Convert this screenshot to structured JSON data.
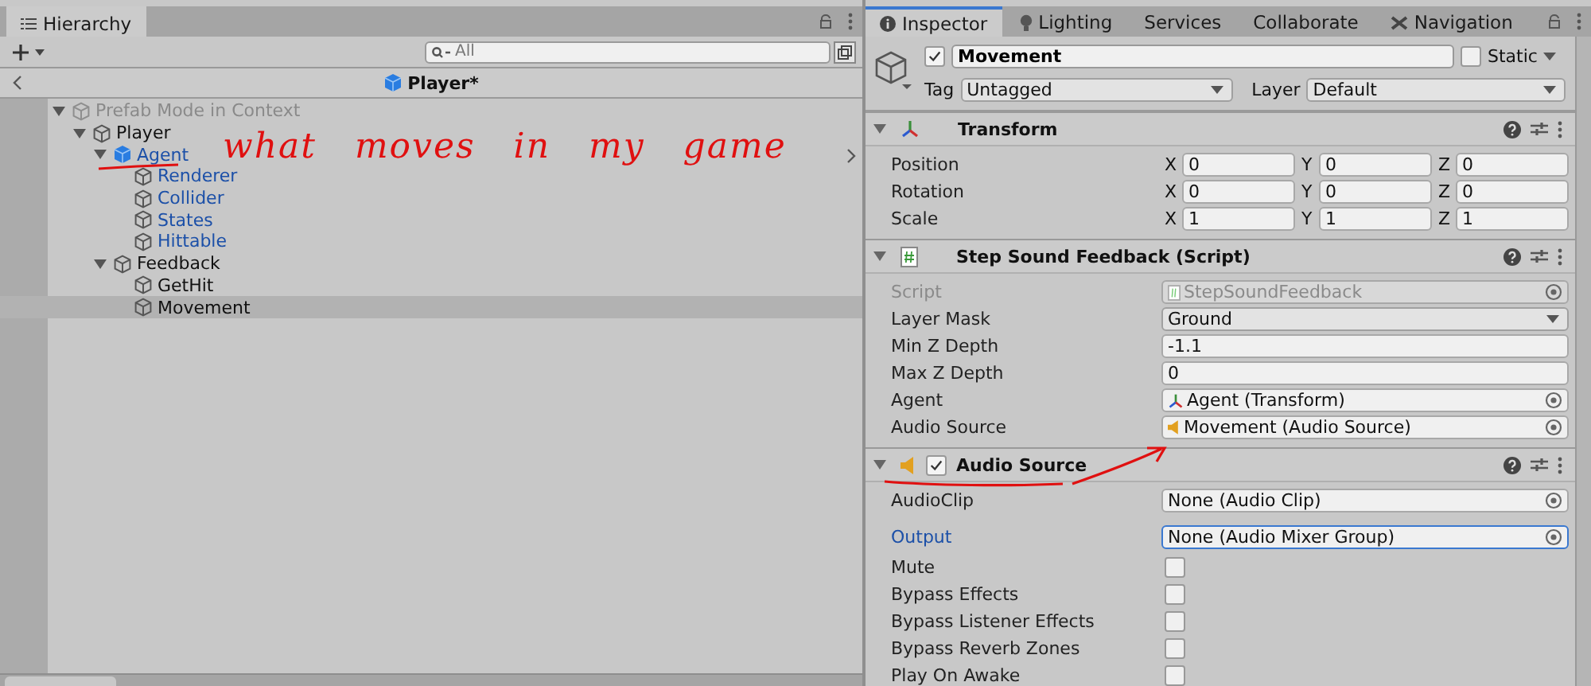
{
  "hierarchy": {
    "tab": "Hierarchy",
    "search": {
      "placeholder": "All"
    },
    "breadcrumb": "Player*",
    "tree": [
      {
        "label": "Prefab Mode in Context",
        "kind": "context",
        "expanded": true,
        "selected": false,
        "children": [
          {
            "label": "Player",
            "kind": "object",
            "expanded": true,
            "selected": false,
            "children": [
              {
                "label": "Agent",
                "kind": "prefab_root",
                "expanded": true,
                "selected": false,
                "children": [
                  {
                    "label": "Renderer",
                    "kind": "prefab_child",
                    "selected": false
                  },
                  {
                    "label": "Collider",
                    "kind": "prefab_child",
                    "selected": false
                  },
                  {
                    "label": "States",
                    "kind": "prefab_child",
                    "selected": false
                  },
                  {
                    "label": "Hittable",
                    "kind": "prefab_child",
                    "selected": false
                  }
                ]
              },
              {
                "label": "Feedback",
                "kind": "object",
                "expanded": true,
                "selected": false,
                "children": [
                  {
                    "label": "GetHit",
                    "kind": "object",
                    "selected": false
                  },
                  {
                    "label": "Movement",
                    "kind": "object",
                    "selected": true
                  }
                ]
              }
            ]
          }
        ]
      }
    ],
    "annotation": "what moves in my game"
  },
  "inspector": {
    "tabs": [
      {
        "label": "Inspector",
        "kind": "info",
        "selected": true
      },
      {
        "label": "Lighting",
        "kind": "lighting",
        "selected": false
      },
      {
        "label": "Services",
        "kind": "plain",
        "selected": false
      },
      {
        "label": "Collaborate",
        "kind": "plain",
        "selected": false
      },
      {
        "label": "Navigation",
        "kind": "navigation",
        "selected": false
      }
    ],
    "object": {
      "active": true,
      "name": "Movement",
      "static_label": "Static",
      "static": false,
      "tag_label": "Tag",
      "tag": "Untagged",
      "layer_label": "Layer",
      "layer": "Default"
    },
    "components": [
      {
        "title": "Transform",
        "kind": "transform",
        "expanded": true,
        "rows": [
          {
            "kind": "vector3",
            "label": "Position",
            "values": [
              {
                "axis": "X",
                "value": "0"
              },
              {
                "axis": "Y",
                "value": "0"
              },
              {
                "axis": "Z",
                "value": "0"
              }
            ]
          },
          {
            "kind": "vector3",
            "label": "Rotation",
            "values": [
              {
                "axis": "X",
                "value": "0"
              },
              {
                "axis": "Y",
                "value": "0"
              },
              {
                "axis": "Z",
                "value": "0"
              }
            ]
          },
          {
            "kind": "vector3",
            "label": "Scale",
            "values": [
              {
                "axis": "X",
                "value": "1"
              },
              {
                "axis": "Y",
                "value": "1"
              },
              {
                "axis": "Z",
                "value": "1"
              }
            ]
          }
        ]
      },
      {
        "title": "Step Sound Feedback (Script)",
        "kind": "script",
        "expanded": true,
        "rows": [
          {
            "kind": "script_ref",
            "label": "Script",
            "value": "StepSoundFeedback",
            "disabled": true
          },
          {
            "kind": "dropdown",
            "label": "Layer Mask",
            "value": "Ground"
          },
          {
            "kind": "text",
            "label": "Min Z Depth",
            "value": "-1.1"
          },
          {
            "kind": "text",
            "label": "Max Z Depth",
            "value": "0"
          },
          {
            "kind": "transform_ref",
            "label": "Agent",
            "value": "Agent (Transform)",
            "disabled": false
          },
          {
            "kind": "audio_ref",
            "label": "Audio Source",
            "value": "Movement (Audio Source)",
            "disabled": false
          }
        ]
      },
      {
        "title": "Audio Source",
        "kind": "audio_source",
        "expanded": true,
        "enabled": true,
        "rows": [
          {
            "kind": "object_ref",
            "label": "AudioClip",
            "value": "None (Audio Clip)",
            "disabled": false
          },
          {
            "kind": "object_ref",
            "label": "Output",
            "value": "None (Audio Mixer Group)",
            "disabled": false,
            "highlighted": true
          },
          {
            "kind": "checkbox",
            "label": "Mute",
            "checked": false
          },
          {
            "kind": "checkbox",
            "label": "Bypass Effects",
            "checked": false
          },
          {
            "kind": "checkbox",
            "label": "Bypass Listener Effects",
            "checked": false
          },
          {
            "kind": "checkbox",
            "label": "Bypass Reverb Zones",
            "checked": false
          },
          {
            "kind": "checkbox",
            "label": "Play On Awake",
            "checked": false
          }
        ]
      }
    ]
  }
}
